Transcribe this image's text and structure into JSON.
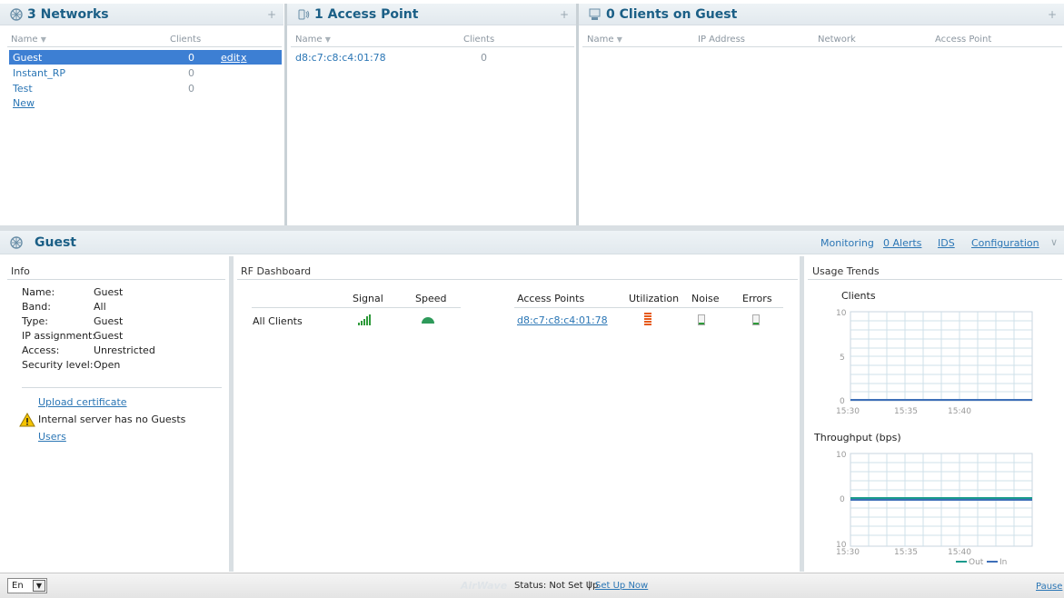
{
  "networks": {
    "title": "3 Networks",
    "col_name": "Name",
    "col_clients": "Clients",
    "rows": [
      {
        "name": "Guest",
        "clients": "0"
      },
      {
        "name": "Instant_RP",
        "clients": "0"
      },
      {
        "name": "Test",
        "clients": "0"
      }
    ],
    "edit_label": "edit",
    "delete_label": "x",
    "new_label": "New"
  },
  "access_points": {
    "title": "1 Access Point",
    "col_name": "Name",
    "col_clients": "Clients",
    "rows": [
      {
        "name": "d8:c7:c8:c4:01:78",
        "clients": "0"
      }
    ]
  },
  "clients": {
    "title": "0 Clients on Guest",
    "col_name": "Name",
    "col_ip": "IP Address",
    "col_network": "Network",
    "col_ap": "Access Point"
  },
  "detail": {
    "title": "Guest",
    "nav": {
      "monitoring": "Monitoring",
      "alerts": "0 Alerts",
      "ids": "IDS",
      "configuration": "Configuration"
    }
  },
  "info": {
    "title": "Info",
    "fields": [
      {
        "label": "Name:",
        "value": "Guest"
      },
      {
        "label": "Band:",
        "value": "All"
      },
      {
        "label": "Type:",
        "value": "Guest"
      },
      {
        "label": "IP assignment:",
        "value": "Guest"
      },
      {
        "label": "Access:",
        "value": "Unrestricted"
      },
      {
        "label": "Security level:",
        "value": "Open"
      }
    ],
    "upload_cert": "Upload certificate",
    "warning": "Internal server has no Guests",
    "users_link": "Users"
  },
  "rf": {
    "title": "RF Dashboard",
    "col_signal": "Signal",
    "col_speed": "Speed",
    "col_aps": "Access Points",
    "col_util": "Utilization",
    "col_noise": "Noise",
    "col_errors": "Errors",
    "row_label": "All Clients",
    "ap_link": "d8:c7:c8:c4:01:78"
  },
  "usage": {
    "title": "Usage Trends",
    "clients_chart": {
      "title": "Clients",
      "y_ticks": [
        "10",
        "5",
        "0"
      ],
      "x_ticks": [
        "15:30",
        "15:35",
        "15:40"
      ]
    },
    "throughput_chart": {
      "title": "Throughput  (bps)",
      "y_ticks": [
        "10",
        "0",
        "10"
      ],
      "x_ticks": [
        "15:30",
        "15:35",
        "15:40"
      ],
      "legend_out": "Out",
      "legend_in": "In"
    }
  },
  "colors": {
    "accent": "#1b5f86",
    "selected_row": "#3d7fd3",
    "link": "#2b76b5",
    "out_series": "#1a9a8c",
    "in_series": "#3d6fb8"
  },
  "footer": {
    "language": "En",
    "brand": "AirWave",
    "status": "Status: Not Set Up",
    "separator": "|",
    "setup_link": "Set Up Now",
    "pause": "Pause"
  }
}
